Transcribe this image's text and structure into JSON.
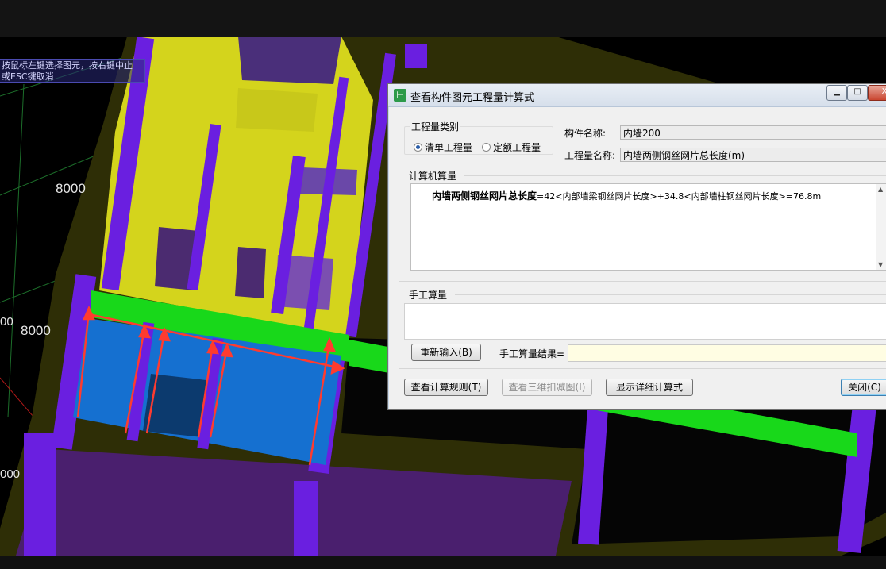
{
  "overlay": {
    "hint_line1": "按鼠标左键选择图元，按右键中止",
    "hint_line2": "或ESC键取消",
    "dimensions": [
      "8000",
      "8000",
      "00",
      "000"
    ]
  },
  "dialog": {
    "title": "查看构件图元工程量计算式",
    "window_buttons": {
      "minimize": "▁",
      "maximize": "□",
      "close": "X"
    },
    "quantity_type": {
      "legend": "工程量类别",
      "options": [
        {
          "label": "清单工程量",
          "selected": true
        },
        {
          "label": "定额工程量",
          "selected": false
        }
      ]
    },
    "component_name_label": "构件名称:",
    "component_name_value": "内墙200",
    "quantity_name_label": "工程量名称:",
    "quantity_name_value": "内墙两侧钢丝网片总长度(m)",
    "computer_calc": {
      "label": "计算机算量",
      "formula_bold": "内墙两侧钢丝网片总长度",
      "formula_rest": "=42<内部墙梁钢丝网片长度>+34.8<内部墙柱钢丝网片长度>=76.8m"
    },
    "manual_calc": {
      "label": "手工算量",
      "reenter_button": "重新输入(B)",
      "result_label": "手工算量结果="
    },
    "buttons": {
      "view_rules": "查看计算规则(T)",
      "view_3d": "查看三维扣减图(I)",
      "show_detail": "显示详细计算式",
      "close": "关闭(C)"
    }
  },
  "colors": {
    "wall_purple": "#6a1fe0",
    "slab_yellow": "#e6e61e",
    "beam_green": "#18d81a",
    "room_blue": "#1570d0",
    "arrow_red": "#ff3b2f"
  }
}
